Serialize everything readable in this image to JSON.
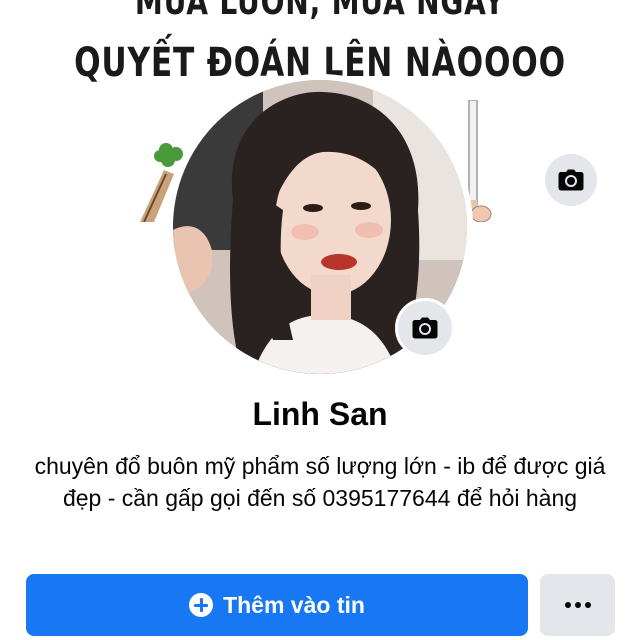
{
  "cover": {
    "line1": "MUA LUÔN, MUA NGAY",
    "line2": "QUYẾT ĐOÁN LÊN NÀOOOO"
  },
  "profile": {
    "name": "Linh San",
    "bio": "chuyên đổ buôn mỹ phẩm số lượng lớn - ib để được giá đẹp - cần gấp gọi đến số 0395177644 để hỏi hàng"
  },
  "actions": {
    "add_story_label": "Thêm vào tin",
    "more_icon": "more-horizontal-icon"
  },
  "icons": {
    "cover_camera": "camera-icon",
    "avatar_camera": "camera-icon",
    "add": "plus-circle-icon"
  },
  "colors": {
    "primary": "#1877f2",
    "secondary_button": "#e4e6eb",
    "text": "#050505"
  }
}
